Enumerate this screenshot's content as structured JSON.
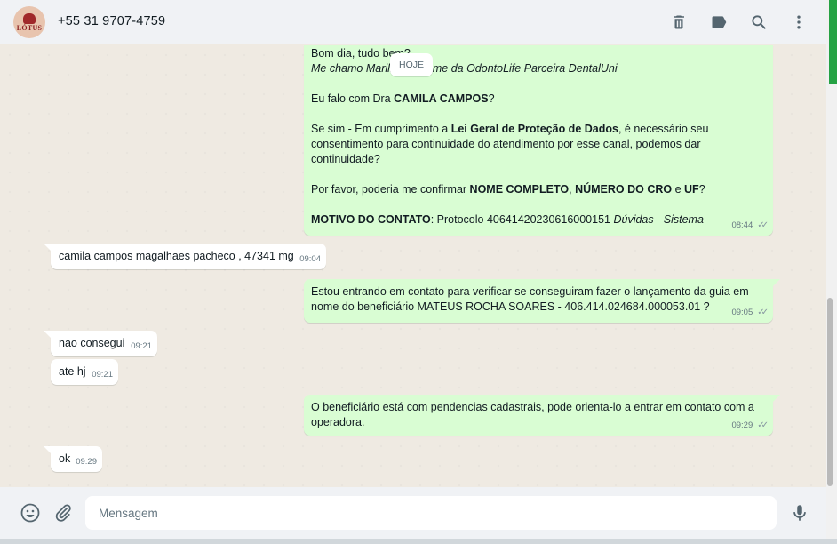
{
  "header": {
    "avatar_text": "LÓTUS",
    "contact_name": "+55 31 9707-4759"
  },
  "date_chip": "HOJE",
  "messages": [
    {
      "lines": [
        "Bom dia, tudo bem?",
        "Me chamo Marilia em nome da OdontoLife Parceira DentalUni"
      ],
      "q1_pre": "Eu falo com Dra ",
      "q1_bold": "CAMILA CAMPOS",
      "q1_post": "?",
      "lgpd_pre": "Se sim - Em cumprimento a ",
      "lgpd_bold": "Lei Geral de Proteção de Dados",
      "lgpd_post": ", é necessário seu",
      "lgpd_line2": "consentimento para continuidade do atendimento por esse canal, podemos dar",
      "lgpd_line3": "continuidade?",
      "confirm_pre": "Por favor, poderia me confirmar ",
      "confirm_b1": "NOME COMPLETO",
      "confirm_sep": ", ",
      "confirm_b2": "NÚMERO DO CRO",
      "confirm_and": " e ",
      "confirm_b3": "UF",
      "confirm_post": "?",
      "motivo_bold": "MOTIVO DO CONTATO",
      "motivo_text": ": Protocolo 40641420230616000151 ",
      "motivo_italic": "Dúvidas - Sistema",
      "time": "08:44"
    },
    {
      "text": "camila campos magalhaes pacheco , 47341 mg",
      "time": "09:04"
    },
    {
      "line1": "Estou entrando em contato para verificar se conseguiram fazer o lançamento da guia em",
      "line2": "nome do beneficiário MATEUS ROCHA SOARES - 406.414.024684.000053.01 ?",
      "time": "09:05"
    },
    {
      "text": "nao consegui",
      "time": "09:21"
    },
    {
      "text": "ate hj",
      "time": "09:21"
    },
    {
      "line1": "O beneficiário está com pendencias cadastrais, pode orienta-lo a entrar em contato com a",
      "line2": "operadora.",
      "time": "09:29"
    },
    {
      "text": "ok",
      "time": "09:29"
    }
  ],
  "composer": {
    "placeholder": "Mensagem"
  },
  "colors": {
    "outgoing_bubble": "#d9fdd3",
    "incoming_bubble": "#ffffff",
    "chat_background": "#efeae2",
    "header_background": "#f0f2f5",
    "scrollbar_accent": "#25a244"
  },
  "icons": [
    "delete-icon",
    "label-icon",
    "search-icon",
    "menu-icon",
    "emoji-icon",
    "attach-icon",
    "mic-icon"
  ]
}
